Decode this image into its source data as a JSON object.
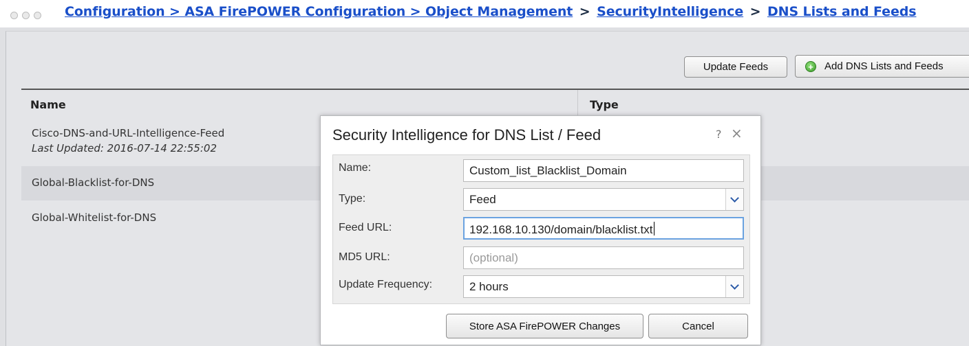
{
  "breadcrumb": {
    "items": [
      {
        "label": "Configuration > ASA FirePOWER Configuration > Object Management",
        "link": true
      },
      {
        "label": ">",
        "link": false
      },
      {
        "label": "SecurityIntelligence",
        "link": true
      },
      {
        "label": ">",
        "link": false
      },
      {
        "label": "DNS Lists and Feeds",
        "link": true
      }
    ]
  },
  "toolbar": {
    "update_feeds_label": "Update Feeds",
    "add_label": "Add DNS Lists and Feeds"
  },
  "table": {
    "columns": [
      "Name",
      "Type"
    ],
    "rows": [
      {
        "name": "Cisco-DNS-and-URL-Intelligence-Feed",
        "sub": "Last Updated: 2016-07-14 22:55:02"
      },
      {
        "name": "Global-Blacklist-for-DNS"
      },
      {
        "name": "Global-Whitelist-for-DNS"
      }
    ]
  },
  "modal": {
    "title": "Security Intelligence for DNS List / Feed",
    "help": "?",
    "close": "×",
    "fields": {
      "name": {
        "label": "Name:",
        "value": "Custom_list_Blacklist_Domain"
      },
      "type": {
        "label": "Type:",
        "value": "Feed"
      },
      "feed_url": {
        "label": "Feed URL:",
        "value": "192.168.10.130/domain/blacklist.txt"
      },
      "md5_url": {
        "label": "MD5 URL:",
        "value": "",
        "placeholder": "(optional)"
      },
      "update_frequency": {
        "label": "Update Frequency:",
        "value": "2 hours"
      }
    },
    "store_label": "Store ASA FirePOWER Changes",
    "cancel_label": "Cancel"
  }
}
